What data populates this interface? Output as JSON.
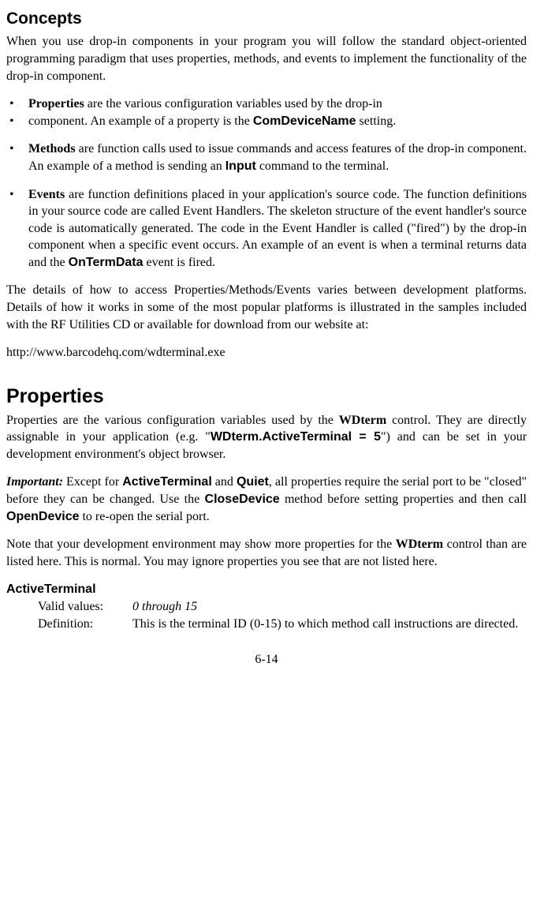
{
  "concepts": {
    "heading": "Concepts",
    "intro": "When you use drop-in components in your program you will follow the standard object-oriented programming paradigm that uses properties, methods, and events to implement the functionality of the drop-in component.",
    "bullet1_pre": "Properties",
    "bullet1_post": " are the various configuration variables used by the drop-in",
    "bullet2_pre": "component. An example of a property is the ",
    "bullet2_code": "ComDeviceName",
    "bullet2_post": " setting.",
    "bullet3_pre": "Methods",
    "bullet3_mid": " are function calls used to issue commands and access features of the drop-in component. An example of a method is sending an ",
    "bullet3_code": "Input",
    "bullet3_post": " command to the terminal.",
    "bullet4_pre": "Events",
    "bullet4_mid": " are function definitions placed in your application's source code. The function definitions in your source code are called Event Handlers. The skeleton structure of the event handler's source code is automatically generated. The code in the Event Handler is called (\"fired\") by the drop-in component when a specific event occurs. An example of an event is when a terminal        returns data and the ",
    "bullet4_code": "OnTermData",
    "bullet4_post": " event is fired.",
    "details": "The details of how to access Properties/Methods/Events varies between development platforms. Details of how it works in some of the most popular platforms is illustrated in the samples included with the RF Utilities CD or available for download from our website at:",
    "url": "http://www.barcodehq.com/wdterminal.exe"
  },
  "properties": {
    "heading": "Properties",
    "intro_pre": "Properties are the various configuration variables used by the ",
    "intro_wd": "WDterm",
    "intro_mid": " control. They are directly assignable in your application (e.g. \"",
    "intro_code": "WDterm.ActiveTerminal = 5",
    "intro_post": "\") and can be set in your development environment's object browser.",
    "important_label": "Important:",
    "important_pre": " Except for ",
    "important_at": "ActiveTerminal",
    "important_and": " and ",
    "important_q": "Quiet",
    "important_mid": ", all properties require the serial port to be \"closed\" before they can be changed. Use the ",
    "important_cd": "CloseDevice",
    "important_mid2": " method before setting properties and then call ",
    "important_od": "OpenDevice",
    "important_post": " to re-open the serial port.",
    "note_pre": "Note that your development environment may show more properties for the ",
    "note_wd": "WDterm",
    "note_post": " control than are listed here. This is normal. You may ignore properties you see that are not listed here.",
    "active_terminal": {
      "name": "ActiveTerminal",
      "valid_label": "Valid values:",
      "valid_value": "0 through 15",
      "def_label": "Definition:",
      "def_value": "This is the terminal ID (0-15) to which method call instructions are directed."
    }
  },
  "page_number": "6-14"
}
